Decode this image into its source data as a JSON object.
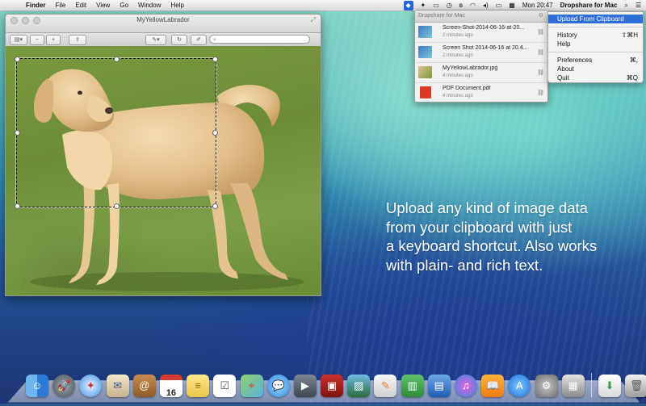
{
  "menubar": {
    "app_name": "Finder",
    "menus": [
      "File",
      "Edit",
      "View",
      "Go",
      "Window",
      "Help"
    ],
    "clock": "Mon 20:47",
    "app_title": "Dropshare for Mac"
  },
  "preview_window": {
    "title": "MyYellowLabrador",
    "search_placeholder": ""
  },
  "dropshare_panel": {
    "header": "Dropshare for Mac",
    "items": [
      {
        "name": "Screen-Shot-2014-06-16-at-20...",
        "time": "2 minutes ago",
        "thumb": "screenshot"
      },
      {
        "name": "Screen Shot 2014-06-16 at 20.4...",
        "time": "2 minutes ago",
        "thumb": "screenshot"
      },
      {
        "name": "MyYellowLabrador.jpg",
        "time": "4 minutes ago",
        "thumb": "photo"
      },
      {
        "name": "PDF Document.pdf",
        "time": "4 minutes ago",
        "thumb": "pdf"
      }
    ]
  },
  "dropdown_menu": {
    "items": [
      {
        "label": "Upload From Clipboard",
        "shortcut": "",
        "highlighted": true
      },
      {
        "label": "History",
        "shortcut": "⇧⌘H"
      },
      {
        "label": "Help",
        "shortcut": ""
      },
      {
        "label": "Preferences",
        "shortcut": "⌘,"
      },
      {
        "label": "About",
        "shortcut": ""
      },
      {
        "label": "Quit",
        "shortcut": "⌘Q"
      }
    ]
  },
  "promo": {
    "lines": [
      "Upload any kind of image data",
      "from your clipboard with just",
      "a keyboard shortcut. Also works",
      "with plain- and rich text."
    ]
  },
  "dock": {
    "apps": [
      "Finder",
      "Launchpad",
      "Safari",
      "Mail",
      "Contacts",
      "Calendar",
      "Notes",
      "Reminders",
      "Maps",
      "Messages",
      "FaceTime",
      "Photo Booth",
      "iPhoto",
      "iTunes",
      "Pages",
      "Numbers",
      "Keynote",
      "App Store",
      "iBooks",
      "System Preferences",
      "Preview",
      "Downloads",
      "Trash"
    ],
    "calendar_day": "16"
  },
  "colors": {
    "menu_highlight": "#2f6ed6",
    "dropshare_brand": "#1d66d6"
  }
}
